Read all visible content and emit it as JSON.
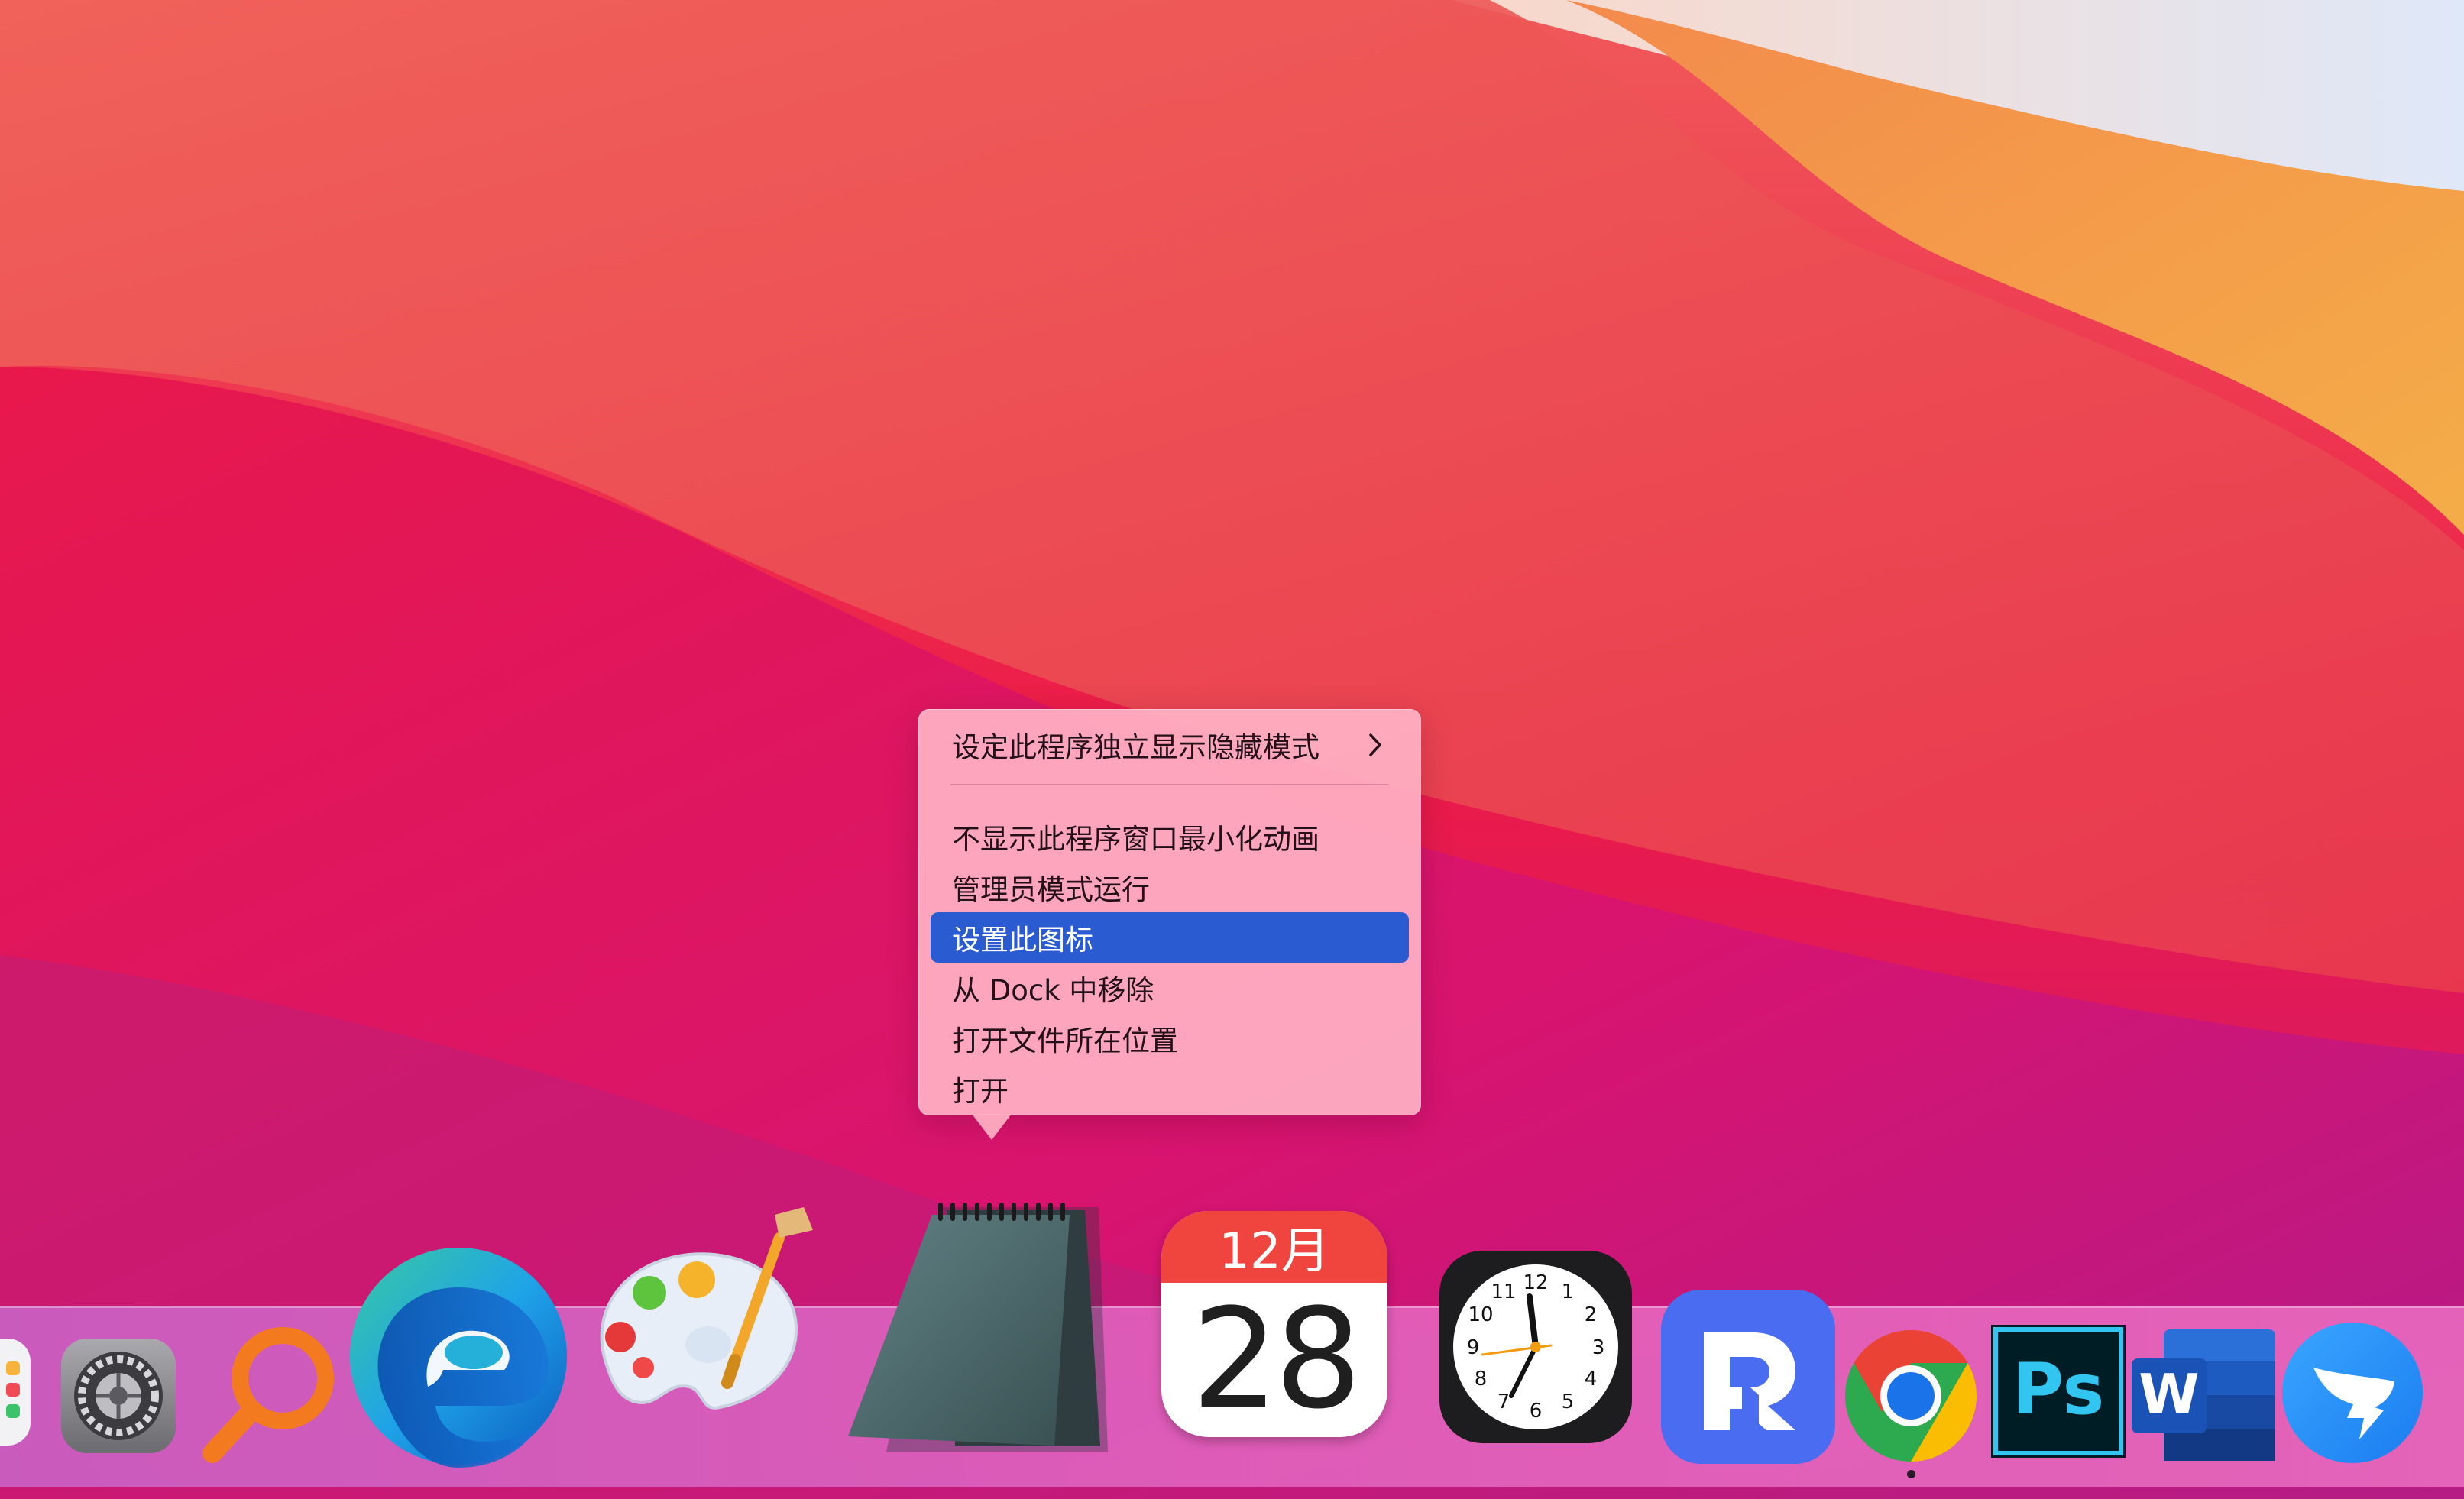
{
  "menu": {
    "items": [
      {
        "label": "设定此程序独立显示隐藏模式",
        "has_submenu": true
      },
      {
        "label": "不显示此程序窗口最小化动画"
      },
      {
        "label": "管理员模式运行"
      },
      {
        "label": "设置此图标",
        "selected": true
      },
      {
        "label": "从 Dock 中移除"
      },
      {
        "label": "打开文件所在位置"
      },
      {
        "label": "打开"
      }
    ],
    "selected_color": "#2a5bd1"
  },
  "dock": {
    "calendar": {
      "month": "12月",
      "day": "28"
    },
    "clock": {
      "numbers": [
        "12",
        "1",
        "2",
        "3",
        "4",
        "5",
        "6",
        "7",
        "8",
        "9",
        "10",
        "11"
      ]
    },
    "photoshop_label": "Ps",
    "word_label": "W",
    "apps": [
      {
        "icon": "launchpad-icon"
      },
      {
        "icon": "system-preferences-icon"
      },
      {
        "icon": "search-magnifier-icon"
      },
      {
        "icon": "edge-icon"
      },
      {
        "icon": "paint-palette-icon"
      },
      {
        "icon": "notepad-icon"
      },
      {
        "icon": "calendar-icon"
      },
      {
        "icon": "clock-icon"
      },
      {
        "icon": "rd-client-icon"
      },
      {
        "icon": "chrome-icon",
        "running": true
      },
      {
        "icon": "photoshop-icon"
      },
      {
        "icon": "word-icon"
      },
      {
        "icon": "dingtalk-icon"
      }
    ]
  },
  "colors": {
    "wallpaper_red": "#ee1c44",
    "wallpaper_coral": "#f16a5a",
    "wallpaper_orange": "#f4a14c",
    "wallpaper_sky": "#dfe8f7",
    "wallpaper_magenta": "#d5156e"
  }
}
